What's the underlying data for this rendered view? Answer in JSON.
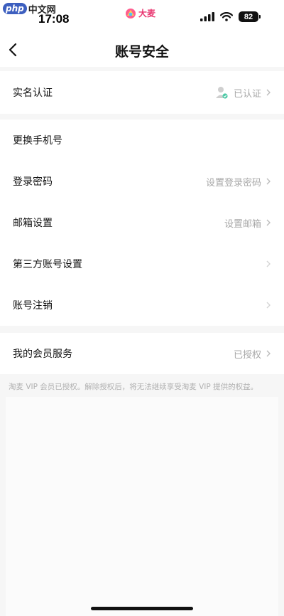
{
  "watermark": {
    "badge": "php",
    "text": "中文网"
  },
  "status_bar": {
    "time": "17:08",
    "brand": "大麦",
    "battery": "82"
  },
  "nav": {
    "title": "账号安全"
  },
  "section1": [
    {
      "label": "实名认证",
      "value": "已认证"
    }
  ],
  "section2": [
    {
      "label": "更换手机号",
      "value": ""
    },
    {
      "label": "登录密码",
      "value": "设置登录密码"
    },
    {
      "label": "邮箱设置",
      "value": "设置邮箱"
    },
    {
      "label": "第三方账号设置",
      "value": ""
    },
    {
      "label": "账号注销",
      "value": ""
    }
  ],
  "section3": [
    {
      "label": "我的会员服务",
      "value": "已授权"
    }
  ],
  "footnote": "淘麦 VIP 会员已授权。解除授权后，将无法继续享受淘麦 VIP 提供的权益。",
  "colors": {
    "accent": "#e8336e",
    "muted": "#a8a8a8",
    "background": "#f6f6f6"
  }
}
